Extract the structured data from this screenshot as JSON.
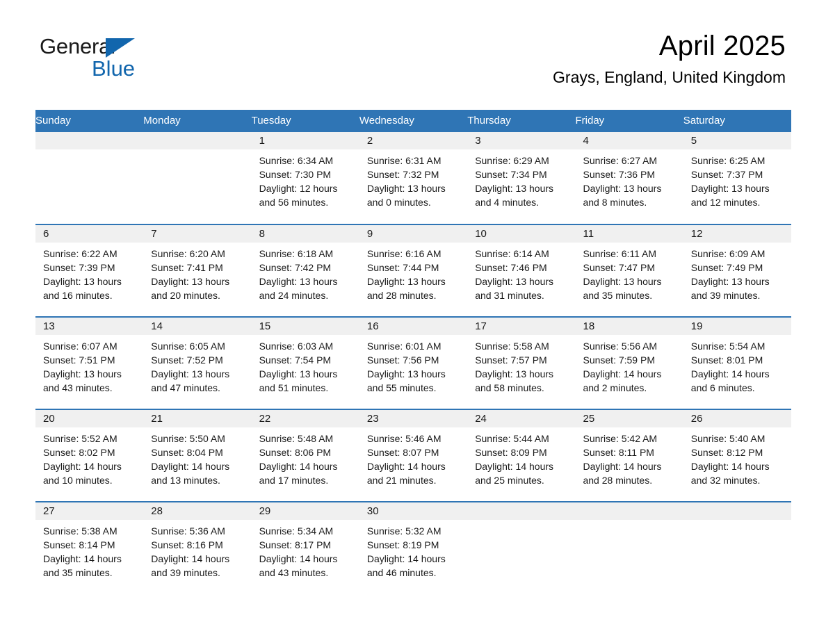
{
  "brand": {
    "name_part1": "General",
    "name_part2": "Blue",
    "accent_color": "#1266ad"
  },
  "header": {
    "title": "April 2025",
    "location": "Grays, England, United Kingdom"
  },
  "theme": {
    "header_blue": "#2f75b5",
    "daynum_band": "#f0f0f0"
  },
  "weekday_headers": [
    "Sunday",
    "Monday",
    "Tuesday",
    "Wednesday",
    "Thursday",
    "Friday",
    "Saturday"
  ],
  "weeks": [
    [
      {
        "day": "",
        "sunrise": "",
        "sunset": "",
        "daylight1": "",
        "daylight2": ""
      },
      {
        "day": "",
        "sunrise": "",
        "sunset": "",
        "daylight1": "",
        "daylight2": ""
      },
      {
        "day": "1",
        "sunrise": "Sunrise: 6:34 AM",
        "sunset": "Sunset: 7:30 PM",
        "daylight1": "Daylight: 12 hours",
        "daylight2": "and 56 minutes."
      },
      {
        "day": "2",
        "sunrise": "Sunrise: 6:31 AM",
        "sunset": "Sunset: 7:32 PM",
        "daylight1": "Daylight: 13 hours",
        "daylight2": "and 0 minutes."
      },
      {
        "day": "3",
        "sunrise": "Sunrise: 6:29 AM",
        "sunset": "Sunset: 7:34 PM",
        "daylight1": "Daylight: 13 hours",
        "daylight2": "and 4 minutes."
      },
      {
        "day": "4",
        "sunrise": "Sunrise: 6:27 AM",
        "sunset": "Sunset: 7:36 PM",
        "daylight1": "Daylight: 13 hours",
        "daylight2": "and 8 minutes."
      },
      {
        "day": "5",
        "sunrise": "Sunrise: 6:25 AM",
        "sunset": "Sunset: 7:37 PM",
        "daylight1": "Daylight: 13 hours",
        "daylight2": "and 12 minutes."
      }
    ],
    [
      {
        "day": "6",
        "sunrise": "Sunrise: 6:22 AM",
        "sunset": "Sunset: 7:39 PM",
        "daylight1": "Daylight: 13 hours",
        "daylight2": "and 16 minutes."
      },
      {
        "day": "7",
        "sunrise": "Sunrise: 6:20 AM",
        "sunset": "Sunset: 7:41 PM",
        "daylight1": "Daylight: 13 hours",
        "daylight2": "and 20 minutes."
      },
      {
        "day": "8",
        "sunrise": "Sunrise: 6:18 AM",
        "sunset": "Sunset: 7:42 PM",
        "daylight1": "Daylight: 13 hours",
        "daylight2": "and 24 minutes."
      },
      {
        "day": "9",
        "sunrise": "Sunrise: 6:16 AM",
        "sunset": "Sunset: 7:44 PM",
        "daylight1": "Daylight: 13 hours",
        "daylight2": "and 28 minutes."
      },
      {
        "day": "10",
        "sunrise": "Sunrise: 6:14 AM",
        "sunset": "Sunset: 7:46 PM",
        "daylight1": "Daylight: 13 hours",
        "daylight2": "and 31 minutes."
      },
      {
        "day": "11",
        "sunrise": "Sunrise: 6:11 AM",
        "sunset": "Sunset: 7:47 PM",
        "daylight1": "Daylight: 13 hours",
        "daylight2": "and 35 minutes."
      },
      {
        "day": "12",
        "sunrise": "Sunrise: 6:09 AM",
        "sunset": "Sunset: 7:49 PM",
        "daylight1": "Daylight: 13 hours",
        "daylight2": "and 39 minutes."
      }
    ],
    [
      {
        "day": "13",
        "sunrise": "Sunrise: 6:07 AM",
        "sunset": "Sunset: 7:51 PM",
        "daylight1": "Daylight: 13 hours",
        "daylight2": "and 43 minutes."
      },
      {
        "day": "14",
        "sunrise": "Sunrise: 6:05 AM",
        "sunset": "Sunset: 7:52 PM",
        "daylight1": "Daylight: 13 hours",
        "daylight2": "and 47 minutes."
      },
      {
        "day": "15",
        "sunrise": "Sunrise: 6:03 AM",
        "sunset": "Sunset: 7:54 PM",
        "daylight1": "Daylight: 13 hours",
        "daylight2": "and 51 minutes."
      },
      {
        "day": "16",
        "sunrise": "Sunrise: 6:01 AM",
        "sunset": "Sunset: 7:56 PM",
        "daylight1": "Daylight: 13 hours",
        "daylight2": "and 55 minutes."
      },
      {
        "day": "17",
        "sunrise": "Sunrise: 5:58 AM",
        "sunset": "Sunset: 7:57 PM",
        "daylight1": "Daylight: 13 hours",
        "daylight2": "and 58 minutes."
      },
      {
        "day": "18",
        "sunrise": "Sunrise: 5:56 AM",
        "sunset": "Sunset: 7:59 PM",
        "daylight1": "Daylight: 14 hours",
        "daylight2": "and 2 minutes."
      },
      {
        "day": "19",
        "sunrise": "Sunrise: 5:54 AM",
        "sunset": "Sunset: 8:01 PM",
        "daylight1": "Daylight: 14 hours",
        "daylight2": "and 6 minutes."
      }
    ],
    [
      {
        "day": "20",
        "sunrise": "Sunrise: 5:52 AM",
        "sunset": "Sunset: 8:02 PM",
        "daylight1": "Daylight: 14 hours",
        "daylight2": "and 10 minutes."
      },
      {
        "day": "21",
        "sunrise": "Sunrise: 5:50 AM",
        "sunset": "Sunset: 8:04 PM",
        "daylight1": "Daylight: 14 hours",
        "daylight2": "and 13 minutes."
      },
      {
        "day": "22",
        "sunrise": "Sunrise: 5:48 AM",
        "sunset": "Sunset: 8:06 PM",
        "daylight1": "Daylight: 14 hours",
        "daylight2": "and 17 minutes."
      },
      {
        "day": "23",
        "sunrise": "Sunrise: 5:46 AM",
        "sunset": "Sunset: 8:07 PM",
        "daylight1": "Daylight: 14 hours",
        "daylight2": "and 21 minutes."
      },
      {
        "day": "24",
        "sunrise": "Sunrise: 5:44 AM",
        "sunset": "Sunset: 8:09 PM",
        "daylight1": "Daylight: 14 hours",
        "daylight2": "and 25 minutes."
      },
      {
        "day": "25",
        "sunrise": "Sunrise: 5:42 AM",
        "sunset": "Sunset: 8:11 PM",
        "daylight1": "Daylight: 14 hours",
        "daylight2": "and 28 minutes."
      },
      {
        "day": "26",
        "sunrise": "Sunrise: 5:40 AM",
        "sunset": "Sunset: 8:12 PM",
        "daylight1": "Daylight: 14 hours",
        "daylight2": "and 32 minutes."
      }
    ],
    [
      {
        "day": "27",
        "sunrise": "Sunrise: 5:38 AM",
        "sunset": "Sunset: 8:14 PM",
        "daylight1": "Daylight: 14 hours",
        "daylight2": "and 35 minutes."
      },
      {
        "day": "28",
        "sunrise": "Sunrise: 5:36 AM",
        "sunset": "Sunset: 8:16 PM",
        "daylight1": "Daylight: 14 hours",
        "daylight2": "and 39 minutes."
      },
      {
        "day": "29",
        "sunrise": "Sunrise: 5:34 AM",
        "sunset": "Sunset: 8:17 PM",
        "daylight1": "Daylight: 14 hours",
        "daylight2": "and 43 minutes."
      },
      {
        "day": "30",
        "sunrise": "Sunrise: 5:32 AM",
        "sunset": "Sunset: 8:19 PM",
        "daylight1": "Daylight: 14 hours",
        "daylight2": "and 46 minutes."
      },
      {
        "day": "",
        "sunrise": "",
        "sunset": "",
        "daylight1": "",
        "daylight2": ""
      },
      {
        "day": "",
        "sunrise": "",
        "sunset": "",
        "daylight1": "",
        "daylight2": ""
      },
      {
        "day": "",
        "sunrise": "",
        "sunset": "",
        "daylight1": "",
        "daylight2": ""
      }
    ]
  ]
}
